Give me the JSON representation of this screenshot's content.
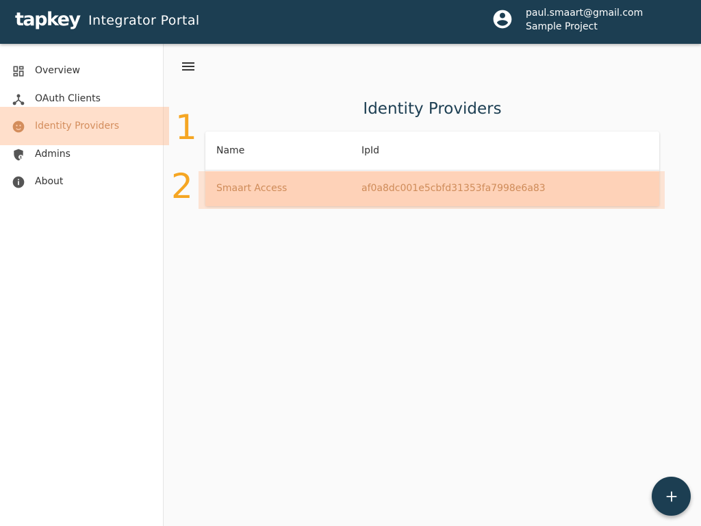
{
  "header": {
    "logo_text": "tapkey",
    "title": "Integrator Portal",
    "user_email": "paul.smaart@gmail.com",
    "project_name": "Sample Project",
    "account_icon": "account-circle-icon"
  },
  "sidebar": {
    "items": [
      {
        "label": "Overview",
        "icon": "dashboard-icon",
        "active": false
      },
      {
        "label": "OAuth Clients",
        "icon": "hub-icon",
        "active": false
      },
      {
        "label": "Identity Providers",
        "icon": "face-icon",
        "active": true
      },
      {
        "label": "Admins",
        "icon": "admin-shield-icon",
        "active": false
      },
      {
        "label": "About",
        "icon": "info-icon",
        "active": false
      }
    ]
  },
  "main": {
    "menu_icon": "menu-icon",
    "page_title": "Identity Providers",
    "table": {
      "columns": [
        "Name",
        "IpId"
      ],
      "rows": [
        {
          "name": "Smaart Access",
          "ipid": "af0a8dc001e5cbfd31353fa7998e6a83"
        }
      ]
    },
    "fab_icon": "add-icon"
  },
  "annotations": {
    "step1": "1",
    "step2": "2",
    "color": "#f5a623",
    "highlight_color": "#ffb78c"
  },
  "colors": {
    "header_bg": "#1c3e52",
    "active_text": "#b06a36",
    "selected_row_bg": "#fde1cf"
  }
}
